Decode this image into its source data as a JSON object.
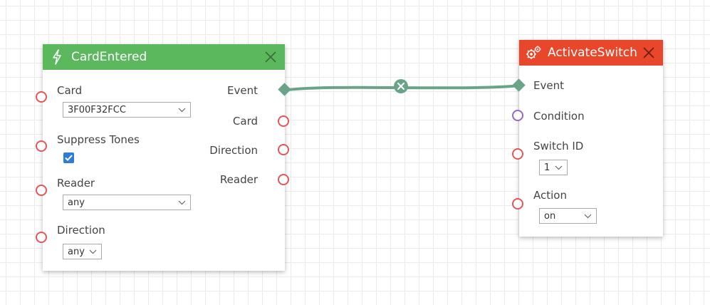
{
  "colors": {
    "trigger_header": "#5cb85c",
    "action_header": "#e9472b",
    "wire": "#6aa488",
    "port_red": "#e35656",
    "port_violet": "#9467c9",
    "checkbox": "#2f7bd9"
  },
  "nodes": {
    "card_entered": {
      "title": "CardEntered",
      "icon": "lightning-icon",
      "inputs": {
        "card": {
          "label": "Card",
          "value": "3F00F32FCC"
        },
        "suppress_tones": {
          "label": "Suppress Tones",
          "checked": true
        },
        "reader": {
          "label": "Reader",
          "value": "any"
        },
        "direction": {
          "label": "Direction",
          "value": "any"
        }
      },
      "outputs": {
        "event": "Event",
        "card": "Card",
        "direction": "Direction",
        "reader": "Reader"
      }
    },
    "activate_switch": {
      "title": "ActivateSwitch",
      "icon": "gears-icon",
      "inputs": {
        "event": {
          "label": "Event"
        },
        "condition": {
          "label": "Condition"
        },
        "switch_id": {
          "label": "Switch ID",
          "value": "1"
        },
        "action": {
          "label": "Action",
          "value": "on"
        }
      }
    }
  },
  "connection": {
    "from": "CardEntered.Event",
    "to": "ActivateSwitch.Event",
    "delete_icon": "close-icon"
  }
}
